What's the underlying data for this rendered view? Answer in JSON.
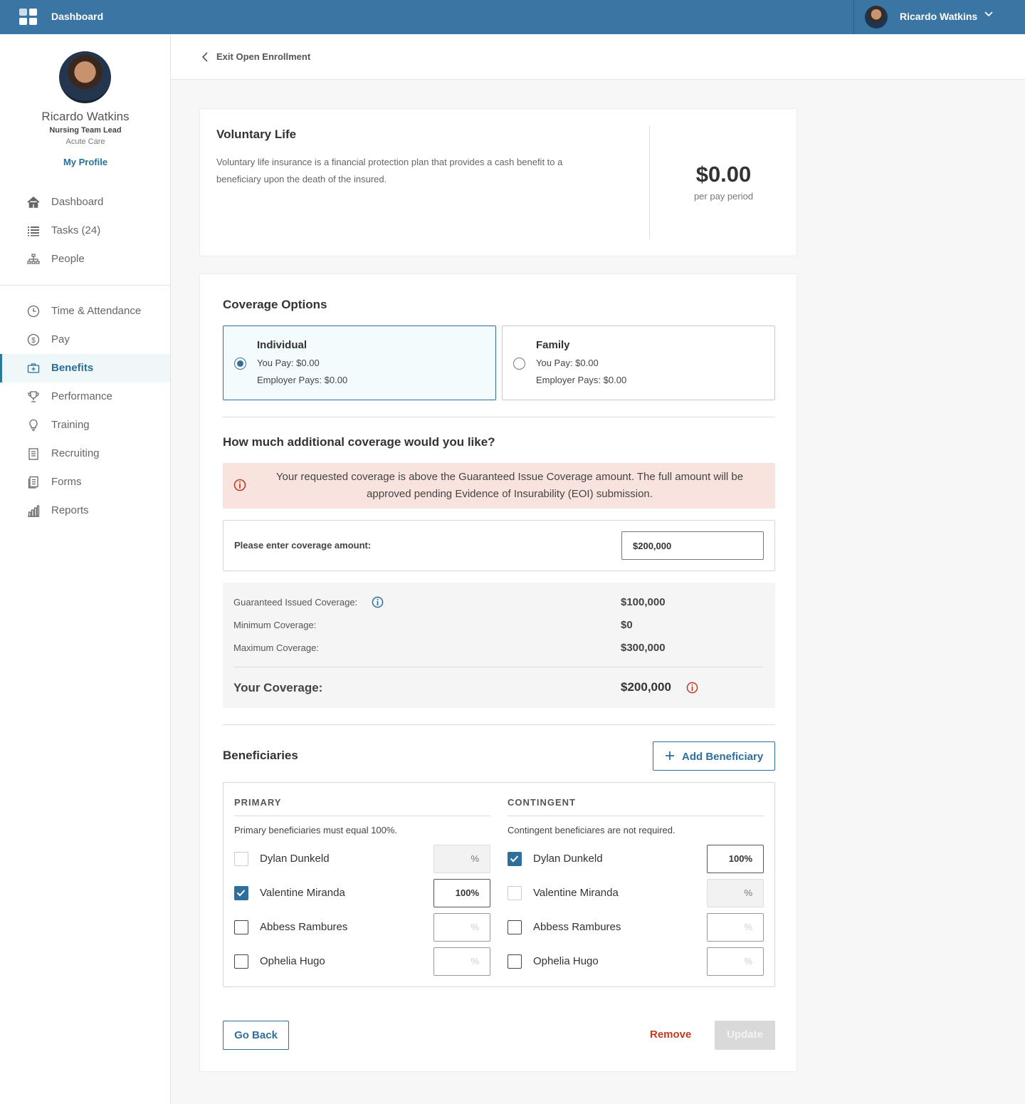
{
  "topbar": {
    "app_title": "Dashboard",
    "user_name": "Ricardo Watkins",
    "brand_color": "#3a75a4"
  },
  "profile": {
    "name": "Ricardo Watkins",
    "role": "Nursing Team Lead",
    "department": "Acute Care",
    "link_label": "My Profile"
  },
  "nav": {
    "items": [
      {
        "label": "Dashboard",
        "icon": "home-icon"
      },
      {
        "label": "Tasks (24)",
        "icon": "list-icon"
      },
      {
        "label": "People",
        "icon": "org-chart-icon"
      },
      {
        "label": "Time & Attendance",
        "icon": "clock-icon"
      },
      {
        "label": "Pay",
        "icon": "dollar-icon"
      },
      {
        "label": "Benefits",
        "icon": "briefcase-icon",
        "active": true
      },
      {
        "label": "Performance",
        "icon": "trophy-icon"
      },
      {
        "label": "Training",
        "icon": "lightbulb-icon"
      },
      {
        "label": "Recruiting",
        "icon": "clipboard-icon"
      },
      {
        "label": "Forms",
        "icon": "forms-icon"
      },
      {
        "label": "Reports",
        "icon": "bar-chart-icon"
      }
    ]
  },
  "subheader": {
    "back_label": "Exit Open Enrollment"
  },
  "plan": {
    "title": "Voluntary Life",
    "description": "Voluntary life insurance is a financial protection plan that provides a cash benefit to a beneficiary upon the death of the insured.",
    "price": "$0.00",
    "period": "per pay period"
  },
  "coverage_options": {
    "title": "Coverage Options",
    "options": [
      {
        "name": "Individual",
        "you_pay": "You Pay: $0.00",
        "employer_pays": "Employer Pays: $0.00",
        "selected": true
      },
      {
        "name": "Family",
        "you_pay": "You Pay: $0.00",
        "employer_pays": "Employer Pays: $0.00",
        "selected": false
      }
    ]
  },
  "additional": {
    "title": "How much additional coverage would you like?",
    "alert": "Your requested coverage is above the Guaranteed Issue Coverage amount. The full amount will be approved pending Evidence of Insurability (EOI) submission.",
    "amount_label": "Please enter coverage amount:",
    "amount_value": "$200,000",
    "guaranteed_label": "Guaranteed Issued Coverage:",
    "guaranteed_value": "$100,000",
    "minimum_label": "Minimum Coverage:",
    "minimum_value": "$0",
    "maximum_label": "Maximum Coverage:",
    "maximum_value": "$300,000",
    "your_label": "Your Coverage:",
    "your_value": "$200,000"
  },
  "beneficiaries": {
    "title": "Beneficiaries",
    "add_label": "Add Beneficiary",
    "primary": {
      "heading": "PRIMARY",
      "note": "Primary beneficiaries must equal 100%.",
      "rows": [
        {
          "name": "Dylan Dunkeld",
          "checked": false,
          "disabled": true,
          "percent": "%"
        },
        {
          "name": "Valentine Miranda",
          "checked": true,
          "disabled": false,
          "percent": "100%"
        },
        {
          "name": "Abbess Rambures",
          "checked": false,
          "disabled": false,
          "percent": "%"
        },
        {
          "name": "Ophelia Hugo",
          "checked": false,
          "disabled": false,
          "percent": "%"
        }
      ]
    },
    "contingent": {
      "heading": "CONTINGENT",
      "note": "Contingent beneficiares are not required.",
      "rows": [
        {
          "name": "Dylan Dunkeld",
          "checked": true,
          "disabled": false,
          "percent": "100%"
        },
        {
          "name": "Valentine Miranda",
          "checked": false,
          "disabled": true,
          "percent": "%"
        },
        {
          "name": "Abbess Rambures",
          "checked": false,
          "disabled": false,
          "percent": "%"
        },
        {
          "name": "Ophelia Hugo",
          "checked": false,
          "disabled": false,
          "percent": "%"
        }
      ]
    }
  },
  "actions": {
    "go_back": "Go Back",
    "remove": "Remove",
    "update": "Update"
  },
  "colors": {
    "accent": "#2f6f9e",
    "alert_bg": "#f9e3df",
    "danger": "#c43a1e"
  }
}
